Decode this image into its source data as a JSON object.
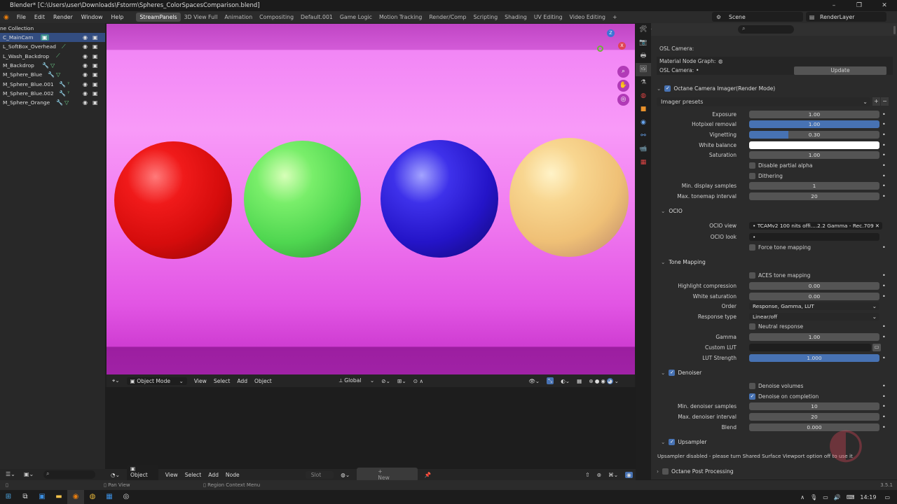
{
  "window_title": "Blender* [C:\\Users\\user\\Downloads\\Fstorm\\Spheres_ColorSpacesComparison.blend]",
  "menu": [
    "File",
    "Edit",
    "Render",
    "Window",
    "Help"
  ],
  "workspaces": [
    "StreamPanels",
    "3D View Full",
    "Animation",
    "Compositing",
    "Default.001",
    "Game Logic",
    "Motion Tracking",
    "Render/Comp",
    "Scripting",
    "Shading",
    "UV Editing",
    "Video Editing"
  ],
  "add_workspace": "+",
  "scene": "Scene",
  "render_layer": "RenderLayer",
  "outliner": {
    "collection": "ne Collection",
    "items": [
      "C_MainCam",
      "L_SoftBox_Overhead",
      "L_Wash_Backdrop",
      "M_Backdrop",
      "M_Sphere_Blue",
      "M_Sphere_Blue.001",
      "M_Sphere_Blue.002",
      "M_Sphere_Orange"
    ]
  },
  "viewport_header": {
    "mode": "Object Mode",
    "menus": [
      "View",
      "Select",
      "Add",
      "Object"
    ],
    "transform": "Global"
  },
  "lower_header": {
    "type": "Object",
    "menus": [
      "View",
      "Select",
      "Add",
      "Node"
    ],
    "slot": "Slot",
    "new": "New"
  },
  "props": {
    "osl_camera_label": "OSL Camera:",
    "material_node_graph": "Material Node Graph:",
    "osl_camera2": "OSL Camera:",
    "update": "Update",
    "imager_title": "Octane Camera Imager(Render Mode)",
    "imager_presets": "Imager presets",
    "exposure_label": "Exposure",
    "exposure": "1.00",
    "hotpixel_label": "Hotpixel removal",
    "hotpixel": "1.00",
    "vignetting_label": "Vignetting",
    "vignetting": "0.30",
    "white_balance_label": "White balance",
    "saturation_label": "Saturation",
    "saturation": "1.00",
    "disable_partial_alpha": "Disable partial alpha",
    "dithering": "Dithering",
    "min_display_label": "Min. display samples",
    "min_display": "1",
    "max_tonemap_label": "Max. tonemap interval",
    "max_tonemap": "20",
    "ocio_title": "OCIO",
    "ocio_view_label": "OCIO view",
    "ocio_view": "TCAMv2 100 nits offi....2.2 Gamma - Rec.709",
    "ocio_look_label": "OCIO look",
    "force_tone": "Force tone mapping",
    "tone_title": "Tone Mapping",
    "aces": "ACES tone mapping",
    "highlight_label": "Highlight compression",
    "highlight": "0.00",
    "white_sat_label": "White saturation",
    "white_sat": "0.00",
    "order_label": "Order",
    "order": "Response, Gamma, LUT",
    "response_label": "Response type",
    "response": "Linear/off",
    "neutral": "Neutral response",
    "gamma_label": "Gamma",
    "gamma": "1.00",
    "custom_lut_label": "Custom LUT",
    "lut_strength_label": "LUT Strength",
    "lut_strength": "1.000",
    "denoiser_title": "Denoiser",
    "denoise_volumes": "Denoise volumes",
    "denoise_completion": "Denoise on completion",
    "min_denoiser_label": "Min. denoiser samples",
    "min_denoiser": "10",
    "max_denoiser_label": "Max. denoiser interval",
    "max_denoiser": "20",
    "blend_label": "Blend",
    "blend": "0.000",
    "upsampler_title": "Upsampler",
    "upsampler_msg": "Upsampler disabled - please turn Shared Surface Viewport option off to use it",
    "post_title": "Octane Post Processing"
  },
  "progress": {
    "vignetting_fill": 0.3
  },
  "status": {
    "pan": "Pan View",
    "region": "Region Context Menu",
    "version": "3.5.1"
  },
  "taskbar": {
    "time": "14:19"
  },
  "colors": {
    "accent": "#4772b3",
    "selected_row": "#334d80",
    "backdrop": "#f89af8"
  }
}
